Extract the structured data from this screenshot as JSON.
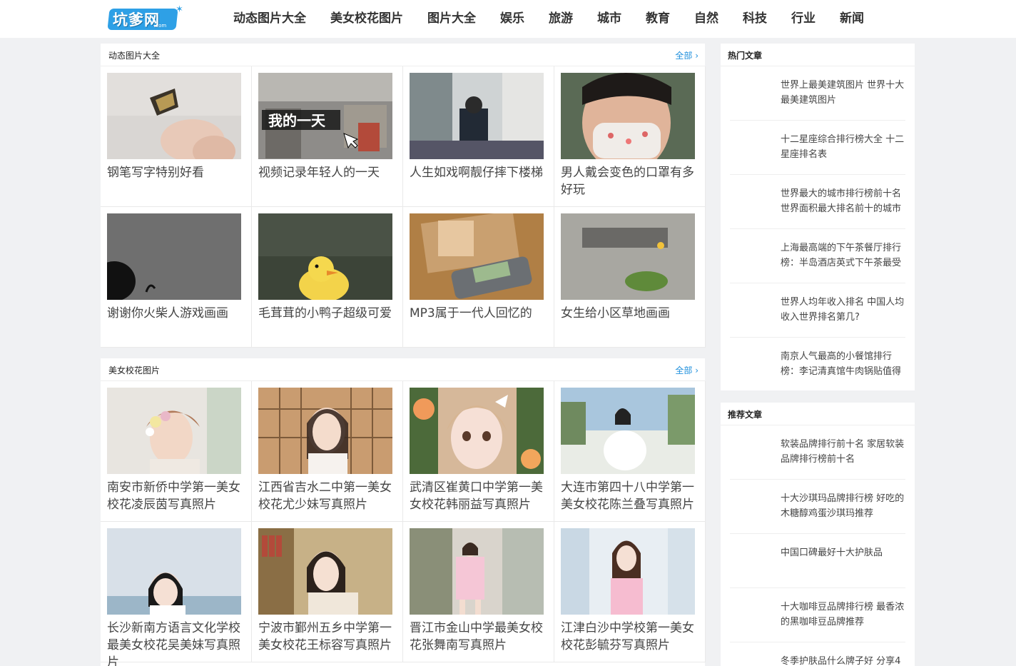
{
  "site": {
    "logo_text": "坑爹网",
    "logo_sub": ".com"
  },
  "nav": [
    "动态图片大全",
    "美女校花图片",
    "图片大全",
    "娱乐",
    "旅游",
    "城市",
    "教育",
    "自然",
    "科技",
    "行业",
    "新闻"
  ],
  "sections": [
    {
      "title": "动态图片大全",
      "more": "全部 ›",
      "items": [
        {
          "caption": "钢笔写字特别好看",
          "thumb": "pen-icon-photo"
        },
        {
          "caption": "视频记录年轻人的一天",
          "thumb": "room-photo",
          "overlay_text": "我的一天"
        },
        {
          "caption": "人生如戏啊靓仔摔下楼梯",
          "thumb": "stairs-photo"
        },
        {
          "caption": "男人戴会变色的口罩有多好玩",
          "thumb": "mask-photo"
        },
        {
          "caption": "谢谢你火柴人游戏画画",
          "thumb": "stickman-photo"
        },
        {
          "caption": "毛茸茸的小鸭子超级可爱",
          "thumb": "duckling-photo"
        },
        {
          "caption": "MP3属于一代人回忆的",
          "thumb": "mp3-photo"
        },
        {
          "caption": "女生给小区草地画画",
          "thumb": "grass-photo"
        }
      ]
    },
    {
      "title": "美女校花图片",
      "more": "全部 ›",
      "items": [
        {
          "caption": "南安市新侨中学第一美女校花凌辰茵写真照片",
          "thumb": "portrait-flowers"
        },
        {
          "caption": "江西省吉水二中第一美女校花尤少妹写真照片",
          "thumb": "portrait-window"
        },
        {
          "caption": "武清区崔黄口中学第一美女校花韩丽益写真照片",
          "thumb": "portrait-closeup"
        },
        {
          "caption": "大连市第四十八中学第一美女校花陈兰叠写真照片",
          "thumb": "portrait-outdoor"
        },
        {
          "caption": "长沙新南方语言文化学校最美女校花吴美妹写真照片",
          "thumb": "portrait-sea"
        },
        {
          "caption": "宁波市鄞州五乡中学第一美女校花王标容写真照片",
          "thumb": "portrait-shelf"
        },
        {
          "caption": "晋江市金山中学最美女校花张舞南写真照片",
          "thumb": "portrait-street"
        },
        {
          "caption": "江津白沙中学校第一美女校花彭毓芬写真照片",
          "thumb": "portrait-pink"
        }
      ]
    }
  ],
  "sidebar": [
    {
      "title": "热门文章",
      "items": [
        "世界上最美建筑图片 世界十大最美建筑图片",
        "十二星座综合排行榜大全 十二星座排名表",
        "世界最大的城市排行榜前十名 世界面积最大排名前十的城市",
        "上海最高端的下午茶餐厅排行榜：半岛酒店英式下午茶最受",
        "世界人均年收入排名 中国人均收入世界排名第几?",
        "南京人气最高的小餐馆排行榜：李记清真馆牛肉锅贴值得"
      ]
    },
    {
      "title": "推荐文章",
      "items": [
        "软装品牌排行前十名 家居软装品牌排行榜前十名",
        "十大沙琪玛品牌排行榜 好吃的木糖醇鸡蛋沙琪玛推荐",
        "中国口碑最好十大护肤品",
        "十大咖啡豆品牌排行榜 最香浓的黑咖啡豆品牌推荐",
        "冬季护肤品什么牌子好 分享4"
      ]
    }
  ]
}
